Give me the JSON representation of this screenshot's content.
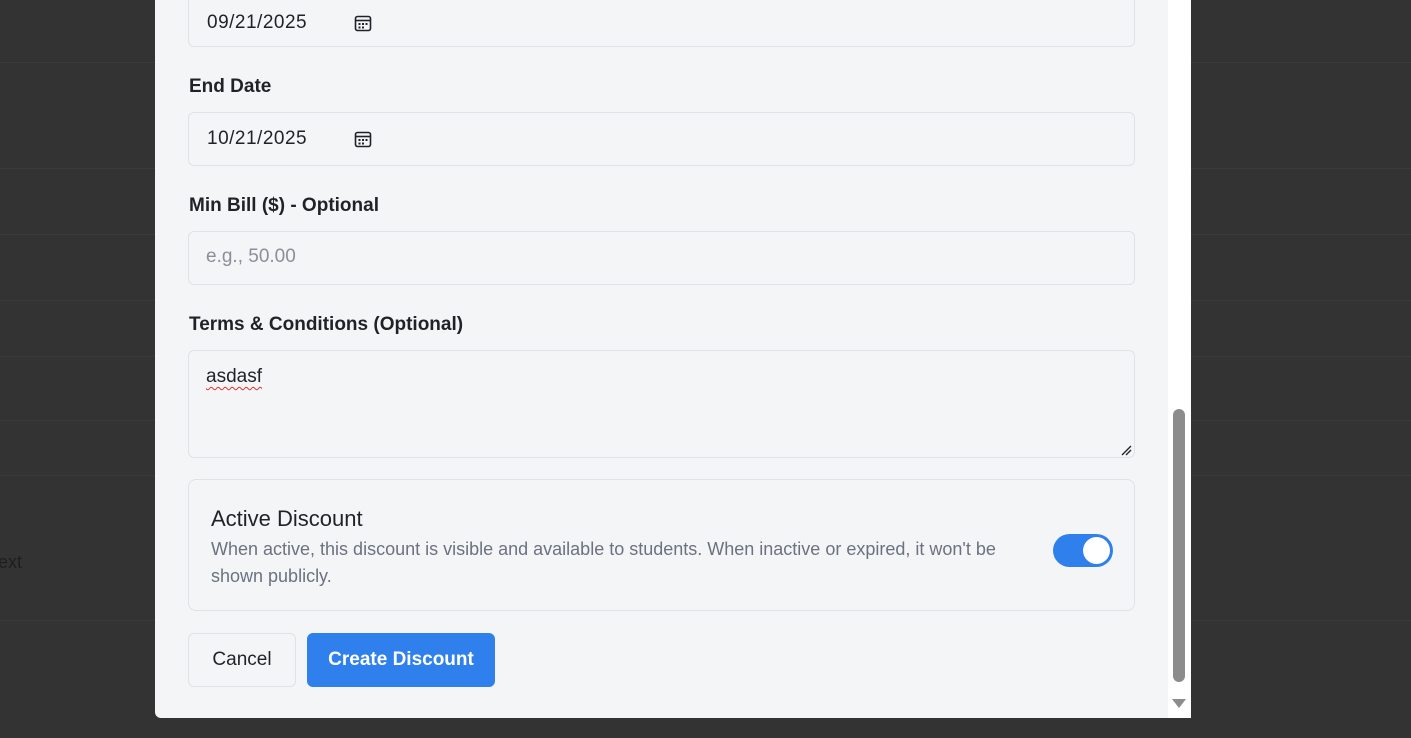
{
  "background": {
    "partial_text": "ext"
  },
  "form": {
    "start_date_value": "09/21/2025",
    "end_date_label": "End Date",
    "end_date_value": "10/21/2025",
    "min_bill_label": "Min Bill ($) - Optional",
    "min_bill_placeholder": "e.g., 50.00",
    "terms_label": "Terms & Conditions (Optional)",
    "terms_value": "asdasf",
    "active": {
      "title": "Active Discount",
      "description": "When active, this discount is visible and available to students. When inactive or expired, it won't be shown publicly.",
      "enabled": true
    }
  },
  "buttons": {
    "cancel": "Cancel",
    "create": "Create Discount"
  },
  "colors": {
    "accent": "#2f80ed",
    "overlay": "#333333",
    "modal_bg": "#f4f5f7"
  },
  "icons": {
    "calendar": "calendar-icon",
    "resize": "resize-grip-icon",
    "scroll_down": "scroll-down-arrow-icon"
  }
}
